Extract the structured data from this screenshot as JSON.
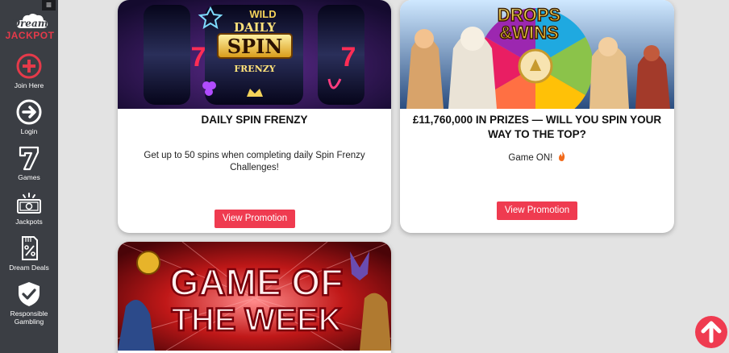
{
  "sidebar": {
    "logo_top": "Dream",
    "logo_bottom": "JACKPOT",
    "menu_icon": "hamburger-icon",
    "items": [
      {
        "label": "Join Here",
        "icon": "plus-circle-icon"
      },
      {
        "label": "Login",
        "icon": "arrow-right-circle-icon"
      },
      {
        "label": "Games",
        "icon": "seven-icon"
      },
      {
        "label": "Jackpots",
        "icon": "cash-icon"
      },
      {
        "label": "Dream Deals",
        "icon": "percent-tag-icon"
      },
      {
        "label": "Responsible Gambling",
        "icon": "shield-check-icon"
      }
    ]
  },
  "promotions": [
    {
      "image_text": {
        "line1": "DAILY",
        "line2": "SPIN",
        "line3": "FRENZY",
        "wild": "WILD",
        "seven": "7"
      },
      "title": "DAILY SPIN FRENZY",
      "description": "Get up to 50 spins when completing daily Spin Frenzy Challenges!",
      "button": "View Promotion"
    },
    {
      "image_text": {
        "line1": "DROPS",
        "line2": "&WINS"
      },
      "title": "£11,760,000 IN PRIZES — WILL YOU SPIN YOUR WAY TO THE TOP?",
      "description": "Game ON!",
      "description_icon": "fire-icon",
      "button": "View Promotion"
    },
    {
      "image_text": {
        "line1": "GAME OF",
        "line2": "THE WEEK"
      }
    }
  ],
  "scroll_top_icon": "arrow-up-icon",
  "colors": {
    "accent": "#ef3b50",
    "sidebar": "#3b3e44",
    "background": "#e3e3e3"
  }
}
